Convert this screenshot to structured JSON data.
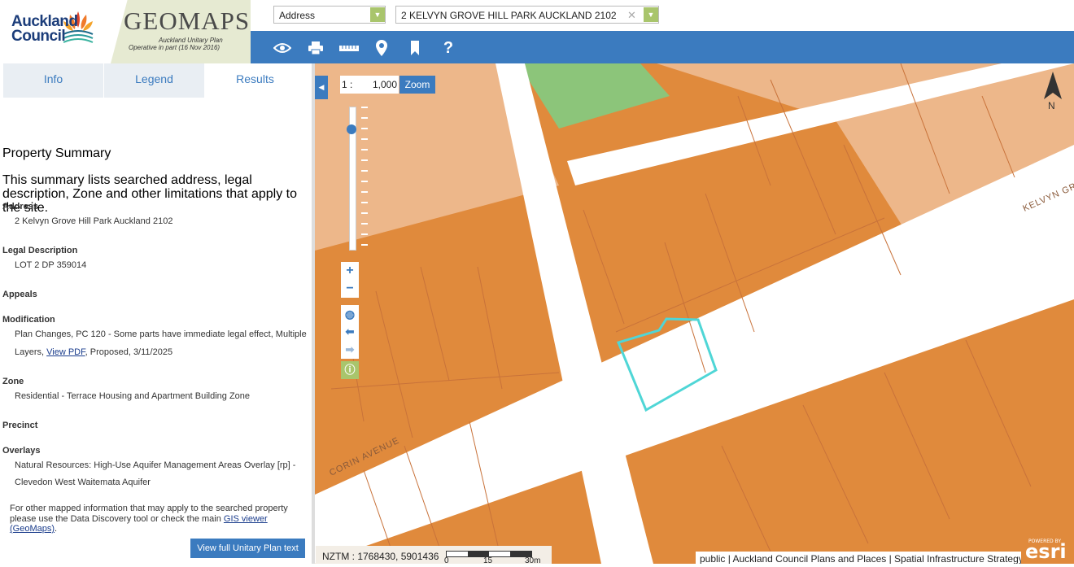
{
  "header": {
    "council_name_line1": "Auckland",
    "council_name_line2": "Council",
    "app_title": "GEOMAPS",
    "app_subtitle_line1": "Auckland Unitary Plan",
    "app_subtitle_line2": "Operative in part (16 Nov 2016)",
    "search_type": "Address",
    "search_value": "2 KELVYN GROVE HILL PARK AUCKLAND 2102",
    "toolbar_icons": [
      "eye-icon",
      "print-icon",
      "ruler-icon",
      "pin-icon",
      "bookmark-icon",
      "help-icon"
    ],
    "help_glyph": "?"
  },
  "tabs": [
    {
      "label": "Info"
    },
    {
      "label": "Legend"
    },
    {
      "label": "Results"
    }
  ],
  "summary": {
    "title": "Property Summary",
    "intro": "This summary lists searched address, legal description, Zone and other limitations that apply to the site.",
    "address_label": "Address",
    "address_value": "2 Kelvyn Grove Hill Park Auckland 2102",
    "legal_label": "Legal Description",
    "legal_value": "LOT 2 DP 359014",
    "appeals_label": "Appeals",
    "modification_label": "Modification",
    "modification_line1": "Plan Changes, PC 120 - Some parts have immediate legal effect, Multiple",
    "modification_line2_pre": "Layers, ",
    "modification_link": "View PDF",
    "modification_line2_post": ", Proposed, 3/11/2025",
    "zone_label": "Zone",
    "zone_value": "Residential - Terrace Housing and Apartment Building Zone",
    "precinct_label": "Precinct",
    "overlays_label": "Overlays",
    "overlays_line1": "Natural Resources: High-Use Aquifer Management Areas Overlay [rp] -",
    "overlays_line2": "Clevedon West Waitemata Aquifer",
    "footer_line1": "For other mapped information that may apply to the searched property",
    "footer_line2_pre": "please use the Data Discovery tool or check the main ",
    "footer_link": "GIS viewer",
    "footer_link2": "(GeoMaps)",
    "footer_end": ".",
    "full_plan_button": "View full Unitary Plan text"
  },
  "map": {
    "scale_prefix": "1 :",
    "scale_value": "1,000",
    "zoom_label": "Zoom",
    "north_label": "N",
    "street_label_1": "KELVYN GROVE",
    "street_label_2": "CORIN AVENUE",
    "coords": "NZTM : 1768430, 5901436",
    "scalebar_labels": [
      "0",
      "15",
      "30m"
    ],
    "attribution": "public | Auckland Council Plans and Places | Spatial Infrastructure Strategy",
    "esri_powered": "POWERED BY",
    "esri_text": "esri",
    "colors": {
      "zone_orange": "#e08a3c",
      "light_orange": "#edb78a",
      "green": "#8cc57a",
      "road": "#ffffff",
      "parcel_highlight": "#4fd6d6",
      "accent_blue": "#3b7bbf"
    }
  }
}
